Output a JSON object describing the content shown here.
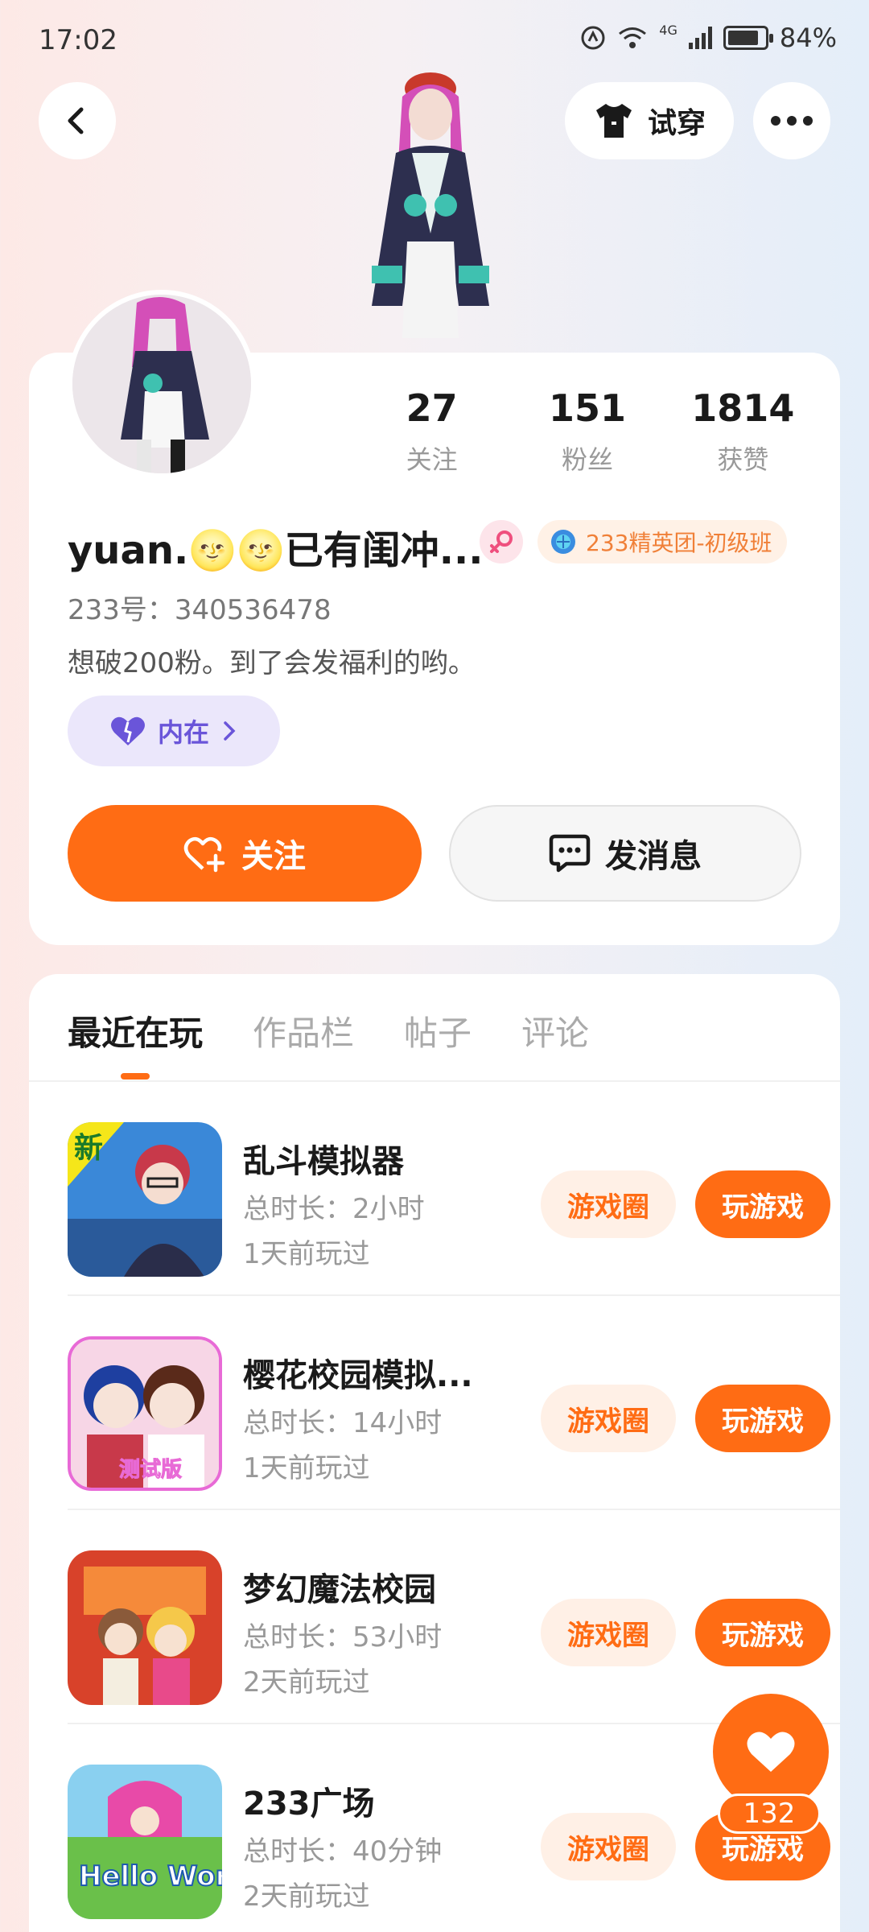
{
  "status_bar": {
    "time": "17:02",
    "network": "4G",
    "battery": "84%",
    "battery_level": 0.84
  },
  "header": {
    "tryon_label": "试穿"
  },
  "profile": {
    "stats": [
      {
        "value": "27",
        "label": "关注"
      },
      {
        "value": "151",
        "label": "粉丝"
      },
      {
        "value": "1814",
        "label": "获赞"
      }
    ],
    "username": "yuan.🌝🌝已有闺冲...",
    "gender": "female",
    "level_badge": "233精英团-初级班",
    "uid": "233号：340536478",
    "bio": "想破200粉。到了会发福利的哟。",
    "inner_label": "内在",
    "follow_label": "关注",
    "message_label": "发消息"
  },
  "tabs": [
    "最近在玩",
    "作品栏",
    "帖子",
    "评论"
  ],
  "games": [
    {
      "name": "乱斗模拟器",
      "duration": "总时长：2小时",
      "last_played": "1天前玩过",
      "circle_label": "游戏圈",
      "play_label": "玩游戏",
      "icon_text": "新"
    },
    {
      "name": "樱花校园模拟...",
      "duration": "总时长：14小时",
      "last_played": "1天前玩过",
      "circle_label": "游戏圈",
      "play_label": "玩游戏",
      "icon_text": "测试版"
    },
    {
      "name": "梦幻魔法校园",
      "duration": "总时长：53小时",
      "last_played": "2天前玩过",
      "circle_label": "游戏圈",
      "play_label": "玩游戏",
      "icon_text": ""
    },
    {
      "name": "233广场",
      "duration": "总时长：40分钟",
      "last_played": "2天前玩过",
      "circle_label": "游戏圈",
      "play_label": "玩游戏",
      "icon_text": "Hello World"
    }
  ],
  "like_fab": {
    "count": "132"
  },
  "colors": {
    "accent": "#ff6c14",
    "accent_light": "#fff0e6",
    "inner_bg": "#ebe7fb",
    "inner_fg": "#6a55d9"
  }
}
